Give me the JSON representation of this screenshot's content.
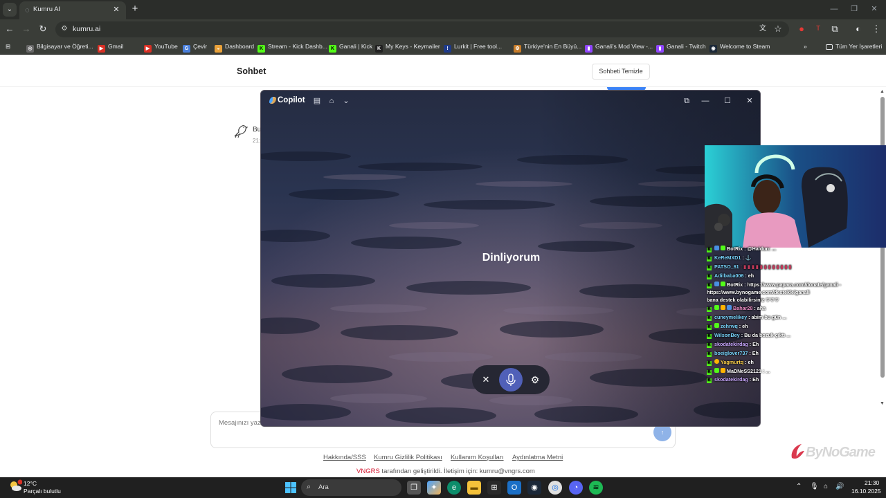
{
  "browser": {
    "tab": {
      "title": "Kumru AI"
    },
    "url": "kumru.ai",
    "bookmarks": [
      {
        "label": "Bilgisayar ve Öğreti..."
      },
      {
        "label": "Gmail"
      },
      {
        "label": "YouTube"
      },
      {
        "label": "Çevir"
      },
      {
        "label": "Dashboard"
      },
      {
        "label": "Stream - Kick Dashb..."
      },
      {
        "label": "Ganali | Kick"
      },
      {
        "label": "My Keys - Keymailer"
      },
      {
        "label": "Lurkit | Free tool..."
      },
      {
        "label": "Türkiye'nin En Büyü..."
      },
      {
        "label": "Ganali's Mod View -..."
      },
      {
        "label": "Ganali - Twitch"
      },
      {
        "label": "Welcome to Steam"
      }
    ],
    "all_bookmarks": "Tüm Yer İşaretleri"
  },
  "page": {
    "title": "Sohbet",
    "clear_button": "Sohbeti Temizle",
    "bot_message_preview": "Bu",
    "bot_time_preview": "21:",
    "input_placeholder": "Mesajınızı yazı",
    "send_icon": "↑",
    "footer_links": [
      "Hakkında/SSS",
      "Kumru Gizlilik Politikası",
      "Kullanım Koşulları",
      "Aydınlatma Metni"
    ],
    "footer_brand": "VNGRS",
    "footer_text": " tarafından geliştirildi. İletişim için: kumru@vngrs.com"
  },
  "copilot": {
    "title": "Copilot",
    "status": "Dinliyorum"
  },
  "stream": {
    "chat": [
      {
        "user": "BotRix",
        "text": ": @Haldun: ...",
        "color": "#ffffff"
      },
      {
        "user": "KeReMXD1",
        "text": ": ⚓",
        "color": "#7ad7ff"
      },
      {
        "user": "PATSO_61",
        "text": ": ▮ ▮ ▮ ▮ ▮ ▮ ▮ ▮ ▮ ▮ ▮ ▮",
        "color": "#7ad7ff"
      },
      {
        "user": "Adilbaba006",
        "text": ": eh",
        "color": "#7ad7ff"
      },
      {
        "user": "BotRix",
        "text": ": https://www.papara.com/donate/ganali -",
        "color": "#ffffff"
      },
      {
        "user": "",
        "text": "https://www.bynogame.com/destekle/ganali",
        "color": "#ffffff"
      },
      {
        "user": "",
        "text": "bana destek olabilirsiniz ♡♡♡",
        "color": "#ffffff"
      },
      {
        "user": "Bahar28",
        "text": ": aha",
        "color": "#f08fc8"
      },
      {
        "user": "cuneymelikey",
        "text": ": abim bu gün ...",
        "color": "#7ad7ff"
      },
      {
        "user": "zehrwq",
        "text": ": eh",
        "color": "#7ad7ff"
      },
      {
        "user": "WilsonBey",
        "text": ": Bu da bozuk çıktı ...",
        "color": "#7ad7ff"
      },
      {
        "user": "skodatekirdag",
        "text": ": Eh",
        "color": "#c9a7ff"
      },
      {
        "user": "boeiglover737",
        "text": ": Eh",
        "color": "#7ad7ff"
      },
      {
        "user": "Yagmurtq",
        "text": ": eh",
        "color": "#ffd24a"
      },
      {
        "user": "MaDNeSS2121",
        "text": ": ...",
        "color": "#ffffff"
      },
      {
        "user": "skodatekirdag",
        "text": ": Eh",
        "color": "#c9a7ff"
      }
    ],
    "watermark": "ByNoGame"
  },
  "taskbar": {
    "temperature": "12°C",
    "weather": "Parçalı bulutlu",
    "search_label": "Ara",
    "time": "21:30",
    "date": "16.10.2025"
  }
}
